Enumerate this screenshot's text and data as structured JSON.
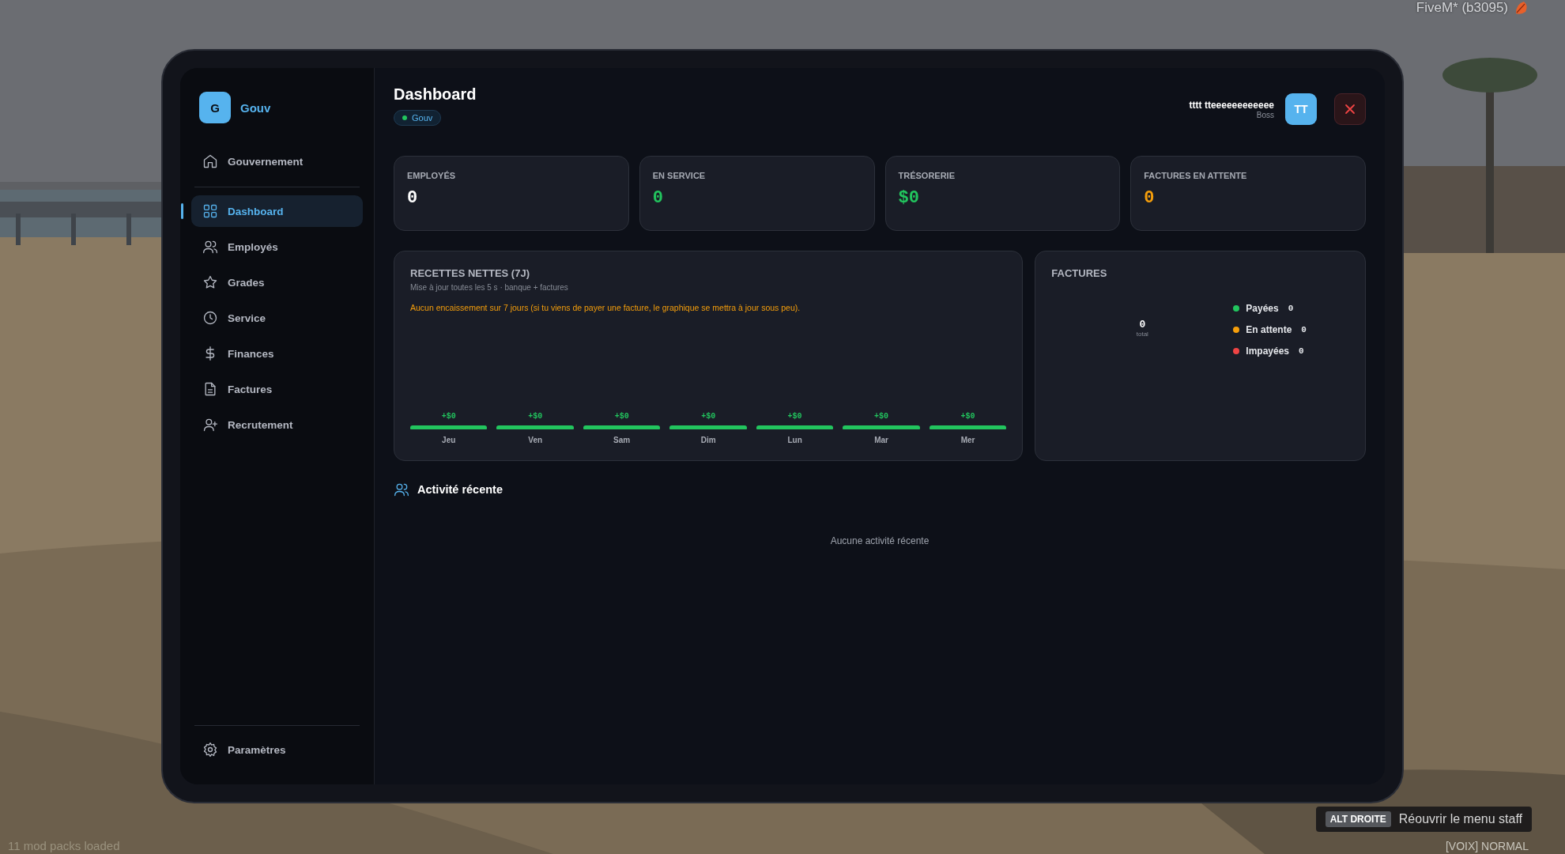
{
  "overlay": {
    "build": "FiveM* (b3095)",
    "mods": "11 mod packs loaded",
    "hint": {
      "key": "ALT DROITE",
      "text": "Réouvrir le menu staff"
    },
    "voice": "[VOIX] NORMAL"
  },
  "sidebar": {
    "brand": {
      "initial": "G",
      "name": "Gouv"
    },
    "section": "Gouvernement",
    "items": [
      {
        "label": "Dashboard",
        "selected": true
      },
      {
        "label": "Employés",
        "selected": false
      },
      {
        "label": "Grades",
        "selected": false
      },
      {
        "label": "Service",
        "selected": false
      },
      {
        "label": "Finances",
        "selected": false
      },
      {
        "label": "Factures",
        "selected": false
      },
      {
        "label": "Recrutement",
        "selected": false
      }
    ],
    "footer": "Paramètres"
  },
  "header": {
    "title": "Dashboard",
    "badge": "Gouv",
    "user": {
      "name": "tttt tteeeeeeeeeeee",
      "role": "Boss",
      "initials": "TT"
    }
  },
  "stats": [
    {
      "label": "EMPLOYÉS",
      "value": "0",
      "color": "#ffffff"
    },
    {
      "label": "EN SERVICE",
      "value": "0",
      "color": "#22c55e"
    },
    {
      "label": "TRÉSORERIE",
      "value": "$0",
      "color": "#22c55e"
    },
    {
      "label": "FACTURES EN ATTENTE",
      "value": "0",
      "color": "#f59e0b"
    }
  ],
  "revenue": {
    "title": "RECETTES NETTES (7J)",
    "subtitle": "Mise à jour toutes les 5 s · banque + factures",
    "notice": "Aucun encaissement sur 7 jours (si tu viens de payer une facture, le graphique se mettra à jour sous peu).",
    "days": [
      {
        "label": "Jeu",
        "value": "+$0"
      },
      {
        "label": "Ven",
        "value": "+$0"
      },
      {
        "label": "Sam",
        "value": "+$0"
      },
      {
        "label": "Dim",
        "value": "+$0"
      },
      {
        "label": "Lun",
        "value": "+$0"
      },
      {
        "label": "Mar",
        "value": "+$0"
      },
      {
        "label": "Mer",
        "value": "+$0"
      }
    ]
  },
  "invoices": {
    "title": "FACTURES",
    "total": "0",
    "total_label": "total",
    "legend": [
      {
        "label": "Payées",
        "value": "0",
        "color": "#22c55e"
      },
      {
        "label": "En attente",
        "value": "0",
        "color": "#f59e0b"
      },
      {
        "label": "Impayées",
        "value": "0",
        "color": "#ef4444"
      }
    ]
  },
  "activity": {
    "title": "Activité récente",
    "empty": "Aucune activité récente"
  }
}
